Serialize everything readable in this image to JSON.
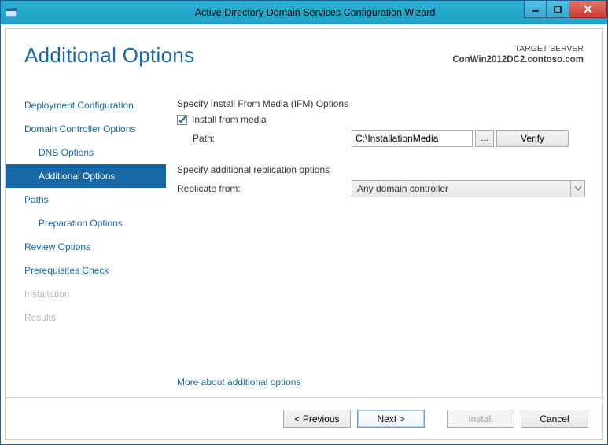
{
  "window": {
    "title": "Active Directory Domain Services Configuration Wizard"
  },
  "header": {
    "page_title": "Additional Options",
    "target_label": "TARGET SERVER",
    "target_server": "ConWin2012DC2.contoso.com"
  },
  "sidebar": {
    "items": [
      {
        "label": "Deployment Configuration",
        "indent": 0,
        "state": "normal"
      },
      {
        "label": "Domain Controller Options",
        "indent": 0,
        "state": "normal"
      },
      {
        "label": "DNS Options",
        "indent": 1,
        "state": "normal"
      },
      {
        "label": "Additional Options",
        "indent": 1,
        "state": "selected"
      },
      {
        "label": "Paths",
        "indent": 0,
        "state": "normal"
      },
      {
        "label": "Preparation Options",
        "indent": 1,
        "state": "normal"
      },
      {
        "label": "Review Options",
        "indent": 0,
        "state": "normal"
      },
      {
        "label": "Prerequisites Check",
        "indent": 0,
        "state": "normal"
      },
      {
        "label": "Installation",
        "indent": 0,
        "state": "disabled"
      },
      {
        "label": "Results",
        "indent": 0,
        "state": "disabled"
      }
    ]
  },
  "content": {
    "ifm_section_title": "Specify Install From Media (IFM) Options",
    "ifm_checkbox_label": "Install from media",
    "ifm_checked": true,
    "path_label": "Path:",
    "path_value": "C:\\InstallationMedia",
    "browse_label": "...",
    "verify_label": "Verify",
    "repl_section_title": "Specify additional replication options",
    "replicate_label": "Replicate from:",
    "replicate_value": "Any domain controller",
    "more_link": "More about additional options"
  },
  "footer": {
    "previous": "< Previous",
    "next": "Next >",
    "install": "Install",
    "cancel": "Cancel"
  }
}
